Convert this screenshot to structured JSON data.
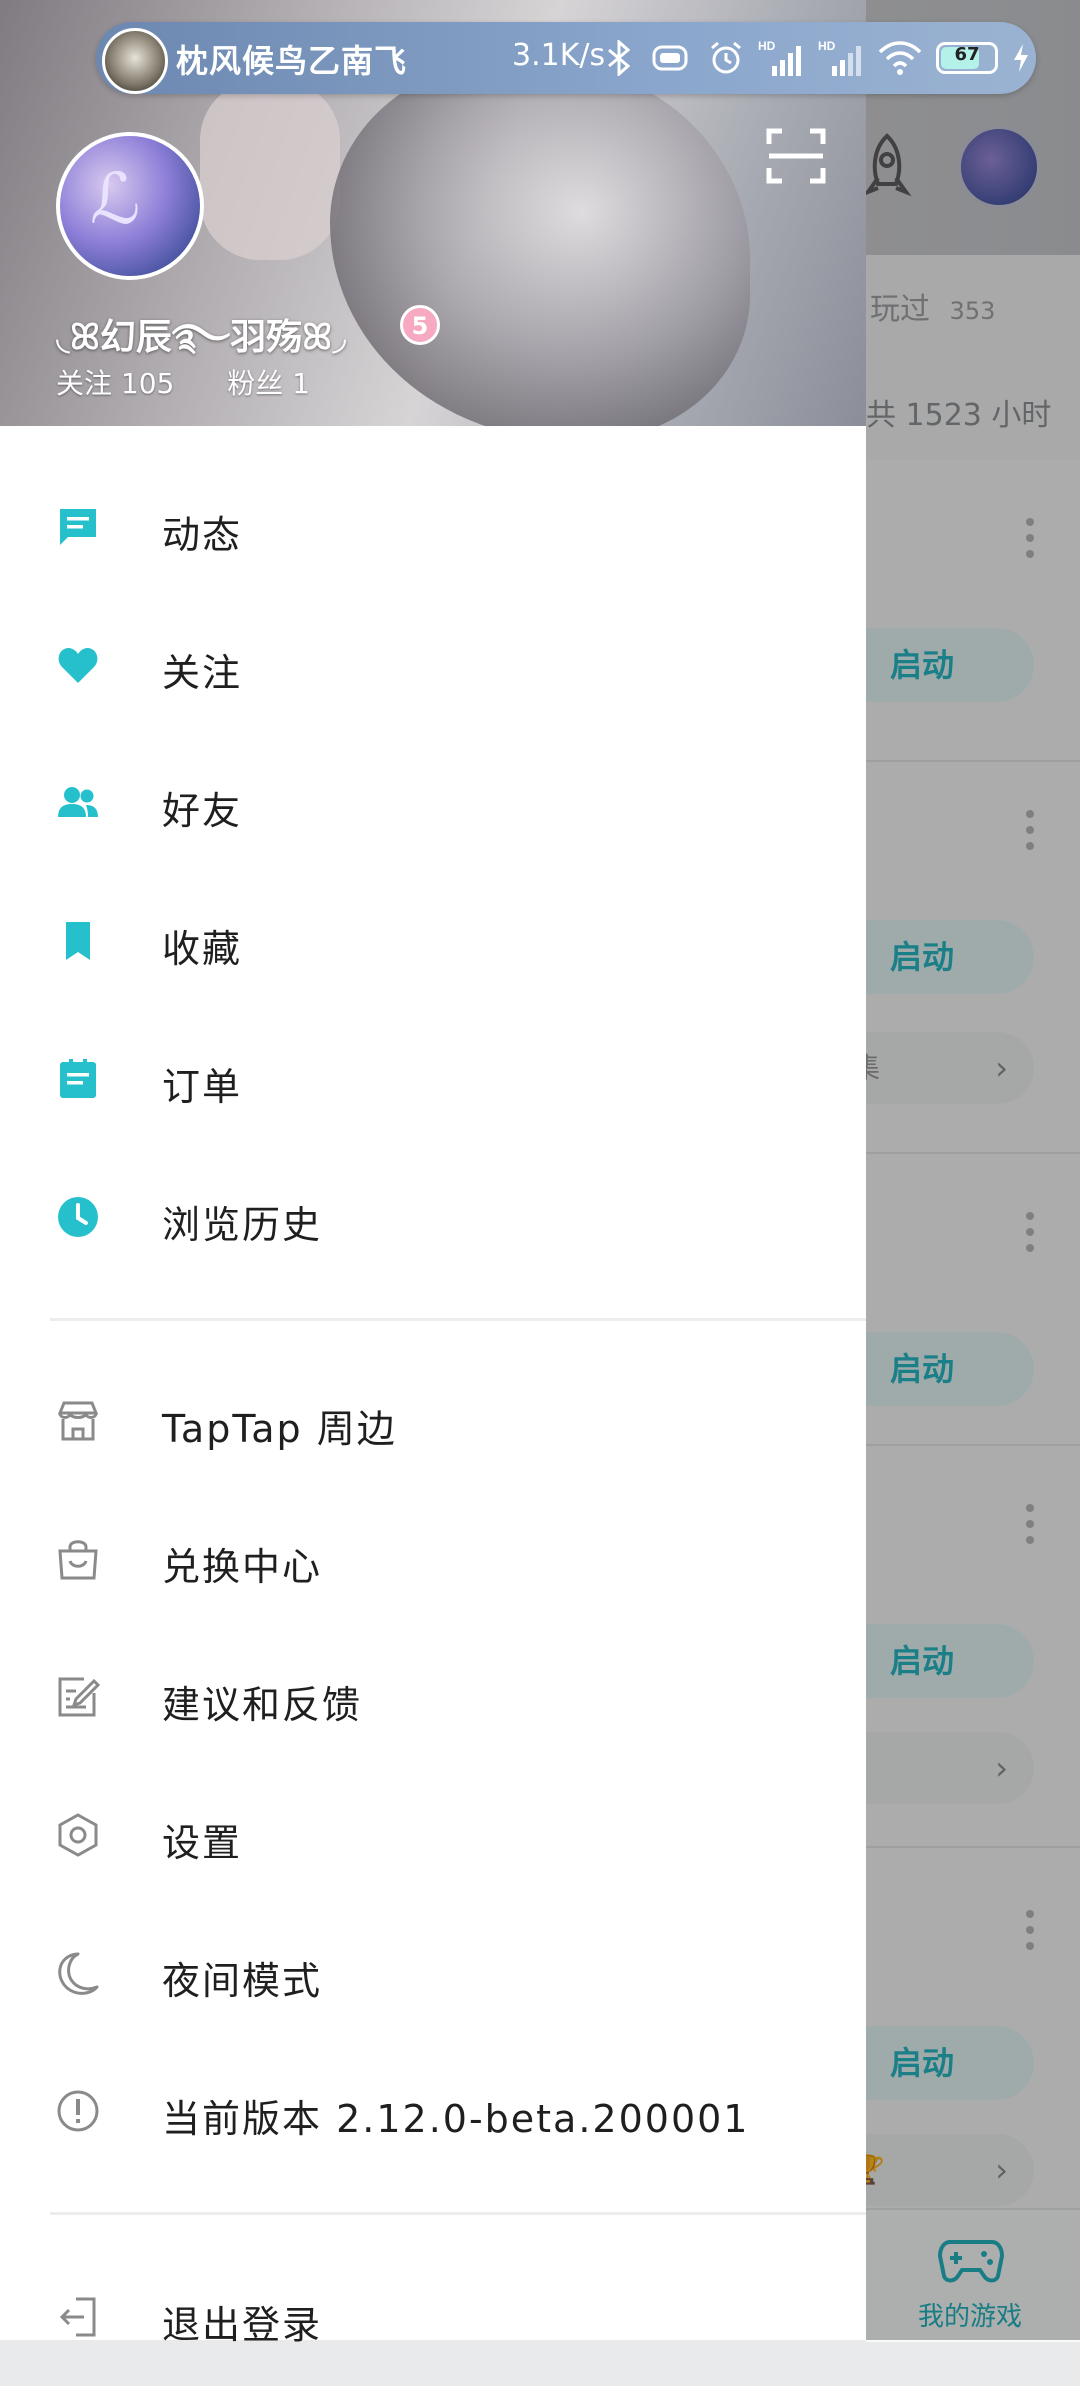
{
  "status_bar": {
    "marquee_text": "枕风候鸟乙南飞",
    "net_speed": "3.1K/s",
    "battery_level": "67",
    "icons": [
      "bluetooth-icon",
      "vibrate-icon",
      "alarm-icon",
      "signal-hd-icon",
      "signal-hd-icon",
      "wifi-icon",
      "battery-icon",
      "charging-icon"
    ]
  },
  "profile": {
    "username": "◟ꕤ幻辰࿐羽殇ꕤ◞",
    "level": "5",
    "following_label": "关注 105",
    "followers_label": "粉丝 1"
  },
  "menu_primary": [
    {
      "label": "动态",
      "icon": "message-icon"
    },
    {
      "label": "关注",
      "icon": "heart-icon"
    },
    {
      "label": "好友",
      "icon": "friends-icon"
    },
    {
      "label": "收藏",
      "icon": "bookmark-icon"
    },
    {
      "label": "订单",
      "icon": "order-icon"
    },
    {
      "label": "浏览历史",
      "icon": "clock-icon"
    }
  ],
  "menu_secondary": [
    {
      "label": "TapTap 周边",
      "icon": "store-icon"
    },
    {
      "label": "兑换中心",
      "icon": "bag-icon"
    },
    {
      "label": "建议和反馈",
      "icon": "edit-icon"
    },
    {
      "label": "设置",
      "icon": "settings-icon"
    },
    {
      "label": "夜间模式",
      "icon": "moon-icon"
    },
    {
      "label": "当前版本 2.12.0-beta.200001",
      "icon": "info-icon"
    }
  ],
  "menu_logout": {
    "label": "退出登录",
    "icon": "logout-icon"
  },
  "background_app": {
    "played_label": "玩过",
    "played_count": "353",
    "playtime_text": "共 1523 小时",
    "launch_label": "启动",
    "collection_chip": "合集",
    "bottom_nav_label": "我的游戏"
  },
  "colors": {
    "accent": "#26c0cc",
    "icon_gray": "#8a8a8a"
  }
}
